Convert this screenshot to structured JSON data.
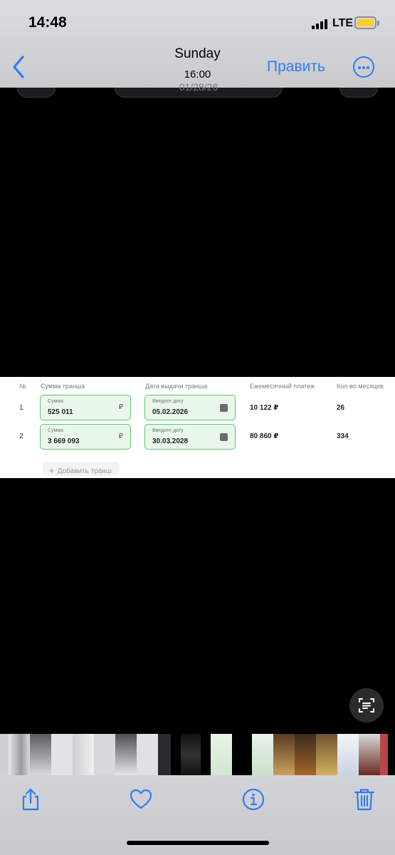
{
  "status_bar": {
    "time": "14:48",
    "network": "LTE"
  },
  "header": {
    "title": "Sunday",
    "subtitle": "16:00",
    "edit_label": "Править"
  },
  "overlay": {
    "date_peek": "01/28/26"
  },
  "table": {
    "headers": [
      "№",
      "Сумма транша",
      "Дата выдачи транша",
      "Ежемесячный платеж",
      "Кол-во месяцев"
    ],
    "rows": [
      {
        "num": "1",
        "amount_label": "Сумма",
        "amount": "525 011",
        "currency": "₽",
        "date_label": "Введите дату",
        "date": "05.02.2026",
        "payment": "10 122 ₽",
        "months": "26"
      },
      {
        "num": "2",
        "amount_label": "Сумма",
        "amount": "3 669 093",
        "currency": "₽",
        "date_label": "Введите дату",
        "date": "30.03.2028",
        "payment": "80 860 ₽",
        "months": "334"
      }
    ],
    "add_label": "Добавить транш"
  },
  "icons": [
    "back-chevron-icon",
    "more-icon",
    "live-text-icon",
    "share-icon",
    "heart-icon",
    "info-icon",
    "trash-icon"
  ],
  "colors": {
    "accent": "#2d7cf6",
    "field_border": "#5ec27a",
    "field_bg": "#e9f7ea"
  }
}
